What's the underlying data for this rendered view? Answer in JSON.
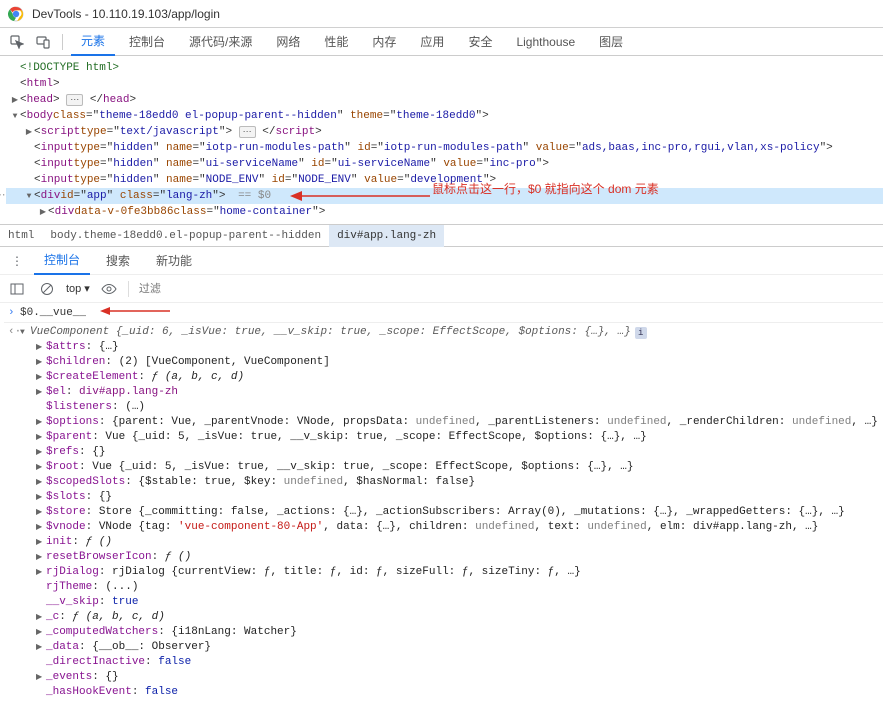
{
  "window": {
    "title": "DevTools - 10.110.19.103/app/login"
  },
  "tabs": {
    "elements": "元素",
    "console": "控制台",
    "sources": "源代码/来源",
    "network": "网络",
    "performance": "性能",
    "memory": "内存",
    "application": "应用",
    "security": "安全",
    "lighthouse": "Lighthouse",
    "layers": "图层"
  },
  "dom": {
    "doctype": "<!DOCTYPE html>",
    "html_open": "<html>",
    "head": "<head> … </head>",
    "body_open": {
      "class": "theme-18edd0 el-popup-parent--hidden",
      "theme": "theme-18edd0"
    },
    "script_line": {
      "type": "text/javascript"
    },
    "inputs": [
      {
        "name": "iotp-run-modules-path",
        "id": "iotp-run-modules-path",
        "value": "ads,baas,inc-pro,rgui,vlan,xs-policy"
      },
      {
        "name": "ui-serviceName",
        "id": "ui-serviceName",
        "value": "inc-pro"
      },
      {
        "name": "NODE_ENV",
        "id": "NODE_ENV",
        "value": "development"
      }
    ],
    "app_div": {
      "id": "app",
      "class": "lang-zh",
      "eq": " == $0"
    },
    "inner_div": {
      "data_v": "data-v-0fe3bb86",
      "class": "home-container"
    }
  },
  "breadcrumbs": {
    "html": "html",
    "body": "body.theme-18edd0.el-popup-parent--hidden",
    "app": "div#app.lang-zh"
  },
  "annotation1": "鼠标点击这一行，$0 就指向这个 dom 元素",
  "console_tabs": {
    "console": "控制台",
    "search": "搜索",
    "whatsnew": "新功能"
  },
  "console_top": {
    "context": "top",
    "context_caret": "▾",
    "filter_placeholder": "过滤"
  },
  "console_input": "$0.__vue__",
  "vue_header": "VueComponent {_uid: 6, _isVue: true, __v_skip: true, _scope: EffectScope, $options: {…}, …}",
  "props": {
    "attrs": {
      "k": "$attrs",
      "v": "{…}"
    },
    "children": {
      "k": "$children",
      "v": "(2) [VueComponent, VueComponent]"
    },
    "createElement": {
      "k": "$createElement",
      "v": "ƒ (a, b, c, d)"
    },
    "el": {
      "k": "$el",
      "v_text": "div#app.lang-zh"
    },
    "listeners": {
      "k": "$listeners",
      "v": "{…}"
    },
    "options": {
      "k": "$options",
      "v_pre": "{parent: Vue, _parentVnode: VNode, propsData: ",
      "v_undef": "undefined",
      "v_mid": ", _parentListeners: ",
      "v_undef2": "undefined",
      "v_post": ", _renderChildren: ",
      "v_undef3": "undefined",
      "v_end": ", …}"
    },
    "parent": {
      "k": "$parent",
      "v": "Vue {_uid: 5, _isVue: true, __v_skip: true, _scope: EffectScope, $options: {…}, …}"
    },
    "refs": {
      "k": "$refs",
      "v": "{}"
    },
    "root": {
      "k": "$root",
      "v": "Vue {_uid: 5, _isVue: true, __v_skip: true, _scope: EffectScope, $options: {…}, …}"
    },
    "scopedSlots": {
      "k": "$scopedSlots",
      "v_pre": "{$stable: true, $key: ",
      "v_undef": "undefined",
      "v_post": ", $hasNormal: false}"
    },
    "slots": {
      "k": "$slots",
      "v": "{}"
    },
    "store": {
      "k": "$store",
      "v": "Store {_committing: false, _actions: {…}, _actionSubscribers: Array(0), _mutations: {…}, _wrappedGetters: {…}, …}"
    },
    "vnode": {
      "k": "$vnode",
      "v_pre": "VNode {tag: ",
      "v_tag": "'vue-component-80-App'",
      "v_mid": ", data: {…}, children: ",
      "v_undef": "undefined",
      "v_mid2": ", text: ",
      "v_undef2": "undefined",
      "v_post": ", elm: div#app.lang-zh, …}"
    },
    "init": {
      "k": "init",
      "v": "ƒ ()"
    },
    "resetBrowserIcon": {
      "k": "resetBrowserIcon",
      "v": "ƒ ()"
    },
    "rjDialog": {
      "k": "rjDialog",
      "v": "rjDialog {currentView: ƒ, title: ƒ, id: ƒ, sizeFull: ƒ, sizeTiny: ƒ, …}"
    },
    "rjTheme": {
      "k": "rjTheme",
      "v": "(...)"
    },
    "v_skip": {
      "k": "__v_skip",
      "v": "true"
    },
    "_c": {
      "k": "_c",
      "v": "ƒ (a, b, c, d)"
    },
    "computedWatchers": {
      "k": "_computedWatchers",
      "v": "{i18nLang: Watcher}"
    },
    "_data": {
      "k": "_data",
      "v": "{__ob__: Observer}"
    },
    "directInactive": {
      "k": "_directInactive",
      "v": "false"
    },
    "_events": {
      "k": "_events",
      "v": "{}"
    },
    "hasHookEvent": {
      "k": "_hasHookEvent",
      "v": "false"
    }
  }
}
